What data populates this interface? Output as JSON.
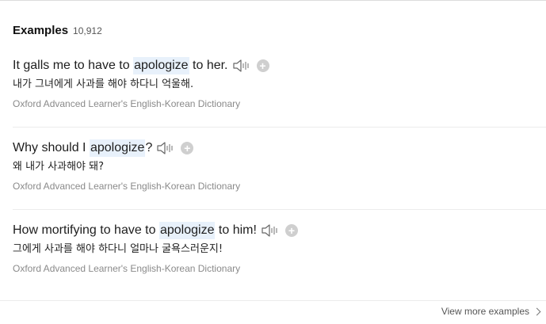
{
  "section": {
    "title": "Examples",
    "count": "10,912"
  },
  "examples": [
    {
      "before": "It galls me to have to ",
      "highlight": "apologize",
      "after": " to her.",
      "ko": "내가 그녀에게 사과를 해야 하다니 억울해.",
      "source": "Oxford Advanced Learner's English-Korean Dictionary"
    },
    {
      "before": "Why should I ",
      "highlight": "apologize",
      "after": "?",
      "ko": "왜 내가 사과해야 돼?",
      "source": "Oxford Advanced Learner's English-Korean Dictionary"
    },
    {
      "before": "How mortifying to have to ",
      "highlight": "apologize",
      "after": " to him!",
      "ko": "그에게 사과를 해야 하다니 얼마나 굴욕스러운지!",
      "source": "Oxford Advanced Learner's English-Korean Dictionary"
    }
  ],
  "footer": {
    "view_more": "View more examples"
  },
  "icons": {
    "speaker": "speaker-icon",
    "add": "plus-circle-icon",
    "chevron": "chevron-right-icon"
  },
  "colors": {
    "highlight_bg": "#e8f1fb",
    "source_text": "#8a8a8a",
    "add_button": "#cfcfcf"
  }
}
